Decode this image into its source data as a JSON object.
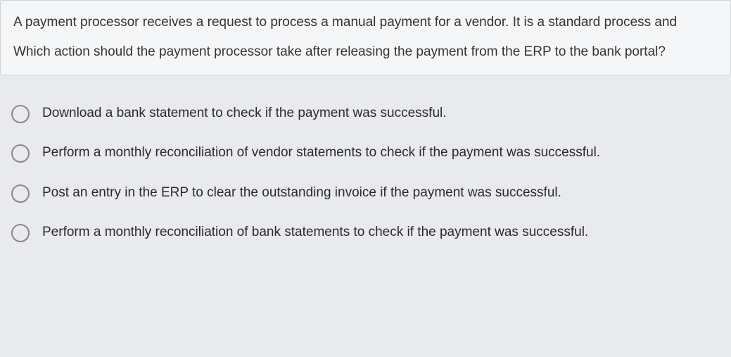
{
  "question": {
    "line1": "A payment processor receives a request to process a manual payment for a vendor. It is a standard process and",
    "line2": "Which action should the payment processor take after releasing the payment from the ERP to the bank portal?"
  },
  "options": [
    {
      "text": "Download a bank statement to check if the payment was successful."
    },
    {
      "text": "Perform a monthly reconciliation of vendor statements to check if the payment was successful."
    },
    {
      "text": "Post an entry in the ERP to clear the outstanding invoice if the payment was successful."
    },
    {
      "text": "Perform a monthly reconciliation of bank statements to check if the payment was successful."
    }
  ]
}
